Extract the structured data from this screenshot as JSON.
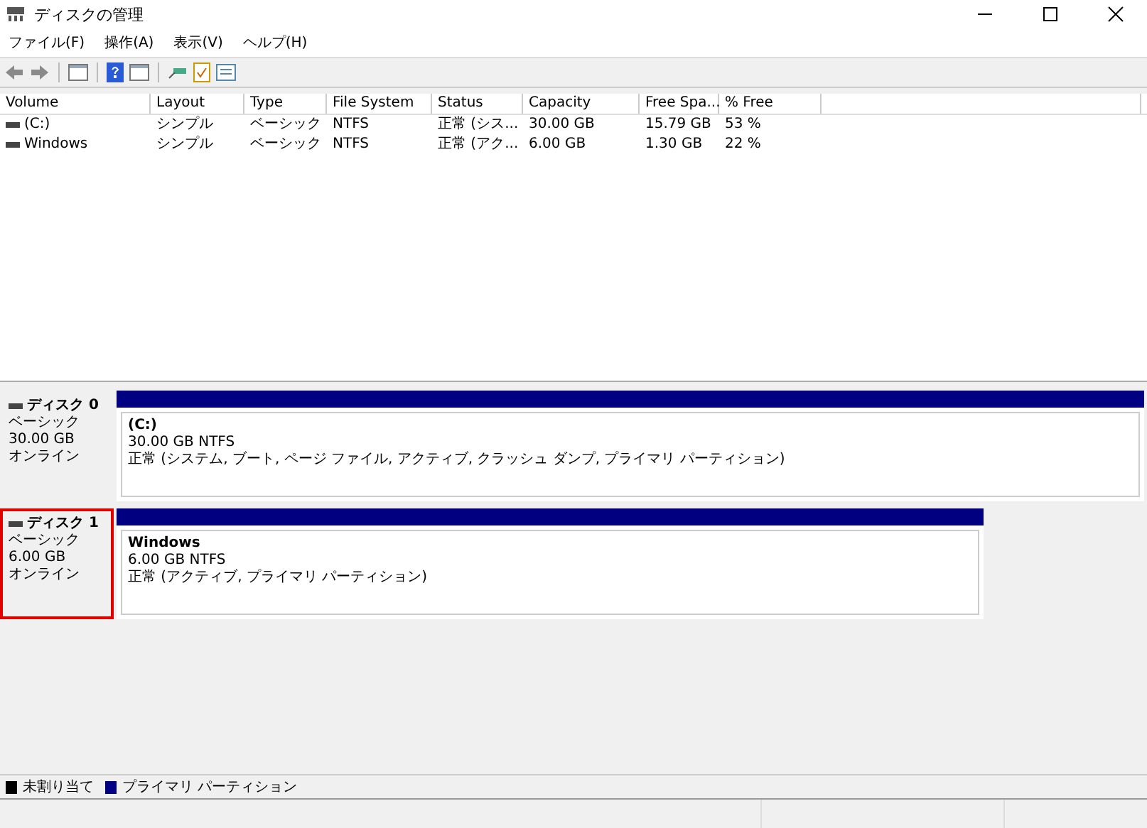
{
  "window": {
    "title": "ディスクの管理"
  },
  "menu": [
    "ファイル(F)",
    "操作(A)",
    "表示(V)",
    "ヘルプ(H)"
  ],
  "table": {
    "columns": [
      "Volume",
      "Layout",
      "Type",
      "File System",
      "Status",
      "Capacity",
      "Free Spa...",
      "% Free"
    ],
    "rows": [
      [
        "(C:)",
        "シンプル",
        "ベーシック",
        "NTFS",
        "正常 (シス...",
        "30.00 GB",
        "15.79 GB",
        "53 %"
      ],
      [
        "Windows",
        "シンプル",
        "ベーシック",
        "NTFS",
        "正常 (アク...",
        "6.00 GB",
        "1.30 GB",
        "22 %"
      ]
    ]
  },
  "disks": [
    {
      "name": "ディスク 0",
      "type": "ベーシック",
      "size": "30.00 GB",
      "state": "オンライン",
      "highlighted": false,
      "partition": {
        "name": "(C:)",
        "size": "30.00 GB NTFS",
        "status": "正常 (システム, ブート, ページ ファイル, アクティブ, クラッシュ ダンプ, プライマリ パーティション)"
      }
    },
    {
      "name": "ディスク 1",
      "type": "ベーシック",
      "size": "6.00 GB",
      "state": "オンライン",
      "highlighted": true,
      "partition": {
        "name": "Windows",
        "size": "6.00 GB NTFS",
        "status": "正常 (アクティブ, プライマリ パーティション)"
      }
    }
  ],
  "legend": [
    {
      "label": "未割り当て",
      "color": "#000000"
    },
    {
      "label": "プライマリ パーティション",
      "color": "#000080"
    }
  ]
}
